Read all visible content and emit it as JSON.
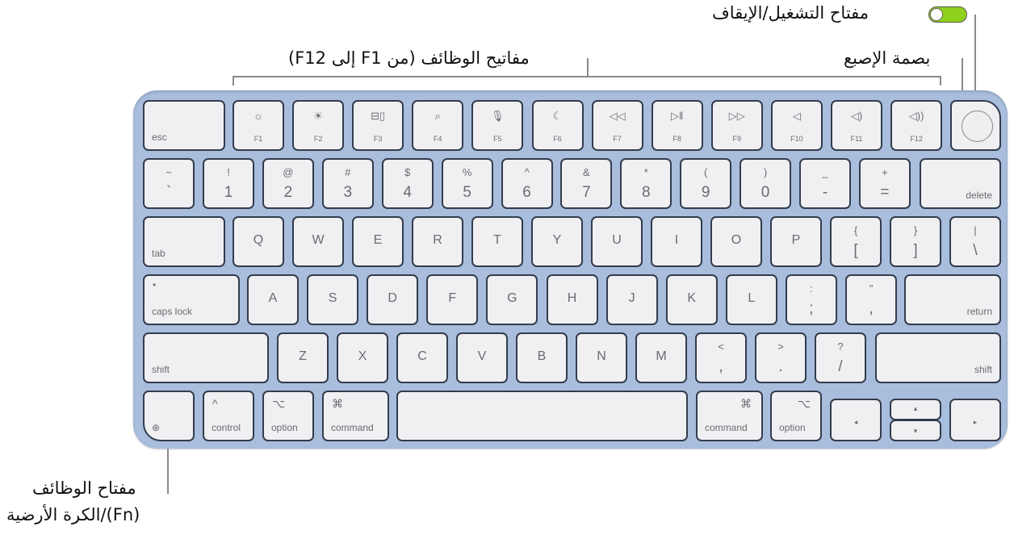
{
  "annotations": {
    "power_switch": "مفتاح التشغيل/الإيقاف",
    "touch_id": "بصمة الإصبع",
    "function_keys": "مفاتيح الوظائف (من F1 إلى F12)",
    "fn_globe_line1": "مفتاح الوظائف",
    "fn_globe_line2": "(Fn)/الكرة الأرضية"
  },
  "colors": {
    "keyboard_body": "#a9bedd",
    "key": "#f0f0f2",
    "key_border": "#333c4c",
    "toggle_on": "#8fd11c"
  },
  "rows": [
    [
      {
        "word": "esc",
        "kind": "wordl"
      },
      {
        "icon": "brightness-down-icon",
        "fnum": "F1",
        "kind": "f"
      },
      {
        "icon": "brightness-up-icon",
        "fnum": "F2",
        "kind": "f"
      },
      {
        "icon": "mission-control-icon",
        "fnum": "F3",
        "kind": "f"
      },
      {
        "icon": "search-icon",
        "fnum": "F4",
        "kind": "f"
      },
      {
        "icon": "microphone-icon",
        "fnum": "F5",
        "kind": "f"
      },
      {
        "icon": "moon-icon",
        "fnum": "F6",
        "kind": "f"
      },
      {
        "icon": "rewind-icon",
        "fnum": "F7",
        "kind": "f"
      },
      {
        "icon": "play-pause-icon",
        "fnum": "F8",
        "kind": "f"
      },
      {
        "icon": "fast-forward-icon",
        "fnum": "F9",
        "kind": "f"
      },
      {
        "icon": "mute-icon",
        "fnum": "F10",
        "kind": "f"
      },
      {
        "icon": "volume-down-icon",
        "fnum": "F11",
        "kind": "f"
      },
      {
        "icon": "volume-up-icon",
        "fnum": "F12",
        "kind": "f"
      },
      {
        "kind": "touchid"
      }
    ],
    [
      {
        "top": "~",
        "bottom": "`",
        "kind": "dual"
      },
      {
        "top": "!",
        "bottom": "1",
        "kind": "dual"
      },
      {
        "top": "@",
        "bottom": "2",
        "kind": "dual"
      },
      {
        "top": "#",
        "bottom": "3",
        "kind": "dual"
      },
      {
        "top": "$",
        "bottom": "4",
        "kind": "dual"
      },
      {
        "top": "%",
        "bottom": "5",
        "kind": "dual"
      },
      {
        "top": "^",
        "bottom": "6",
        "kind": "dual"
      },
      {
        "top": "&",
        "bottom": "7",
        "kind": "dual"
      },
      {
        "top": "*",
        "bottom": "8",
        "kind": "dual"
      },
      {
        "top": "(",
        "bottom": "9",
        "kind": "dual"
      },
      {
        "top": ")",
        "bottom": "0",
        "kind": "dual"
      },
      {
        "top": "_",
        "bottom": "-",
        "kind": "dual"
      },
      {
        "top": "+",
        "bottom": "=",
        "kind": "dual"
      },
      {
        "word": "delete",
        "kind": "wordr"
      }
    ],
    [
      {
        "word": "tab",
        "kind": "wordl"
      },
      {
        "label": "Q",
        "kind": "single"
      },
      {
        "label": "W",
        "kind": "single"
      },
      {
        "label": "E",
        "kind": "single"
      },
      {
        "label": "R",
        "kind": "single"
      },
      {
        "label": "T",
        "kind": "single"
      },
      {
        "label": "Y",
        "kind": "single"
      },
      {
        "label": "U",
        "kind": "single"
      },
      {
        "label": "I",
        "kind": "single"
      },
      {
        "label": "O",
        "kind": "single"
      },
      {
        "label": "P",
        "kind": "single"
      },
      {
        "top": "{",
        "bottom": "[",
        "kind": "dual"
      },
      {
        "top": "}",
        "bottom": "]",
        "kind": "dual"
      },
      {
        "top": "|",
        "bottom": "\\",
        "kind": "dual"
      }
    ],
    [
      {
        "word": "caps lock",
        "dot": "•",
        "kind": "caps"
      },
      {
        "label": "A",
        "kind": "single"
      },
      {
        "label": "S",
        "kind": "single"
      },
      {
        "label": "D",
        "kind": "single"
      },
      {
        "label": "F",
        "kind": "single"
      },
      {
        "label": "G",
        "kind": "single"
      },
      {
        "label": "H",
        "kind": "single"
      },
      {
        "label": "J",
        "kind": "single"
      },
      {
        "label": "K",
        "kind": "single"
      },
      {
        "label": "L",
        "kind": "single"
      },
      {
        "top": ":",
        "bottom": ";",
        "kind": "dual"
      },
      {
        "top": "\"",
        "bottom": ",",
        "kind": "dual"
      },
      {
        "word": "return",
        "kind": "wordr"
      }
    ],
    [
      {
        "word": "shift",
        "kind": "wordl"
      },
      {
        "label": "Z",
        "kind": "single"
      },
      {
        "label": "X",
        "kind": "single"
      },
      {
        "label": "C",
        "kind": "single"
      },
      {
        "label": "V",
        "kind": "single"
      },
      {
        "label": "B",
        "kind": "single"
      },
      {
        "label": "N",
        "kind": "single"
      },
      {
        "label": "M",
        "kind": "single"
      },
      {
        "top": "<",
        "bottom": ",",
        "kind": "dual"
      },
      {
        "top": ">",
        "bottom": ".",
        "kind": "dual"
      },
      {
        "top": "?",
        "bottom": "/",
        "kind": "dual"
      },
      {
        "word": "shift",
        "kind": "wordr"
      }
    ],
    [
      {
        "icon": "globe-icon",
        "kind": "globe"
      },
      {
        "glyph": "^",
        "word": "control",
        "kind": "mod"
      },
      {
        "glyph": "⌥",
        "word": "option",
        "kind": "mod"
      },
      {
        "glyph": "⌘",
        "word": "command",
        "kind": "mod"
      },
      {
        "kind": "space"
      },
      {
        "glyph": "⌘",
        "word": "command",
        "kind": "modr"
      },
      {
        "glyph": "⌥",
        "word": "option",
        "kind": "modr"
      },
      {
        "arrow": "◂",
        "kind": "arrow"
      },
      {
        "up": "▴",
        "down": "▾",
        "kind": "updown"
      },
      {
        "arrow": "▸",
        "kind": "arrow"
      }
    ]
  ]
}
